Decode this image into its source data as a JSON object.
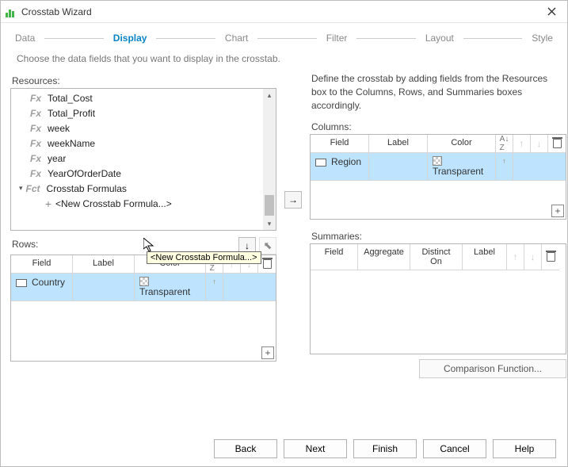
{
  "window": {
    "title": "Crosstab Wizard"
  },
  "tabs": [
    "Data",
    "Display",
    "Chart",
    "Filter",
    "Layout",
    "Style"
  ],
  "active_tab": "Display",
  "subtitle": "Choose the data fields that you want to display in the crosstab.",
  "resources": {
    "label": "Resources:",
    "items": [
      "Total_Cost",
      "Total_Profit",
      "week",
      "weekName",
      "year",
      "YearOfOrderDate"
    ],
    "group": "Crosstab Formulas",
    "group_prefix": "Fct",
    "new_item": "<New Crosstab Formula...>"
  },
  "info": "Define the crosstab by adding fields from the Resources box to the Columns, Rows, and Summaries boxes accordingly.",
  "columns": {
    "label": "Columns:",
    "headers": [
      "Field",
      "Label",
      "Color"
    ],
    "row": {
      "field": "Region",
      "label": "",
      "color": "Transparent"
    }
  },
  "rows": {
    "label": "Rows:",
    "headers": [
      "Field",
      "Label",
      "Color"
    ],
    "row": {
      "field": "Country",
      "label": "",
      "color": "Transparent"
    }
  },
  "summaries": {
    "label": "Summaries:",
    "headers": [
      "Field",
      "Aggregate",
      "Distinct On",
      "Label"
    ]
  },
  "comparison": "Comparison Function...",
  "tooltip": "<New Crosstab Formula...>",
  "buttons": {
    "back": "Back",
    "next": "Next",
    "finish": "Finish",
    "cancel": "Cancel",
    "help": "Help"
  }
}
